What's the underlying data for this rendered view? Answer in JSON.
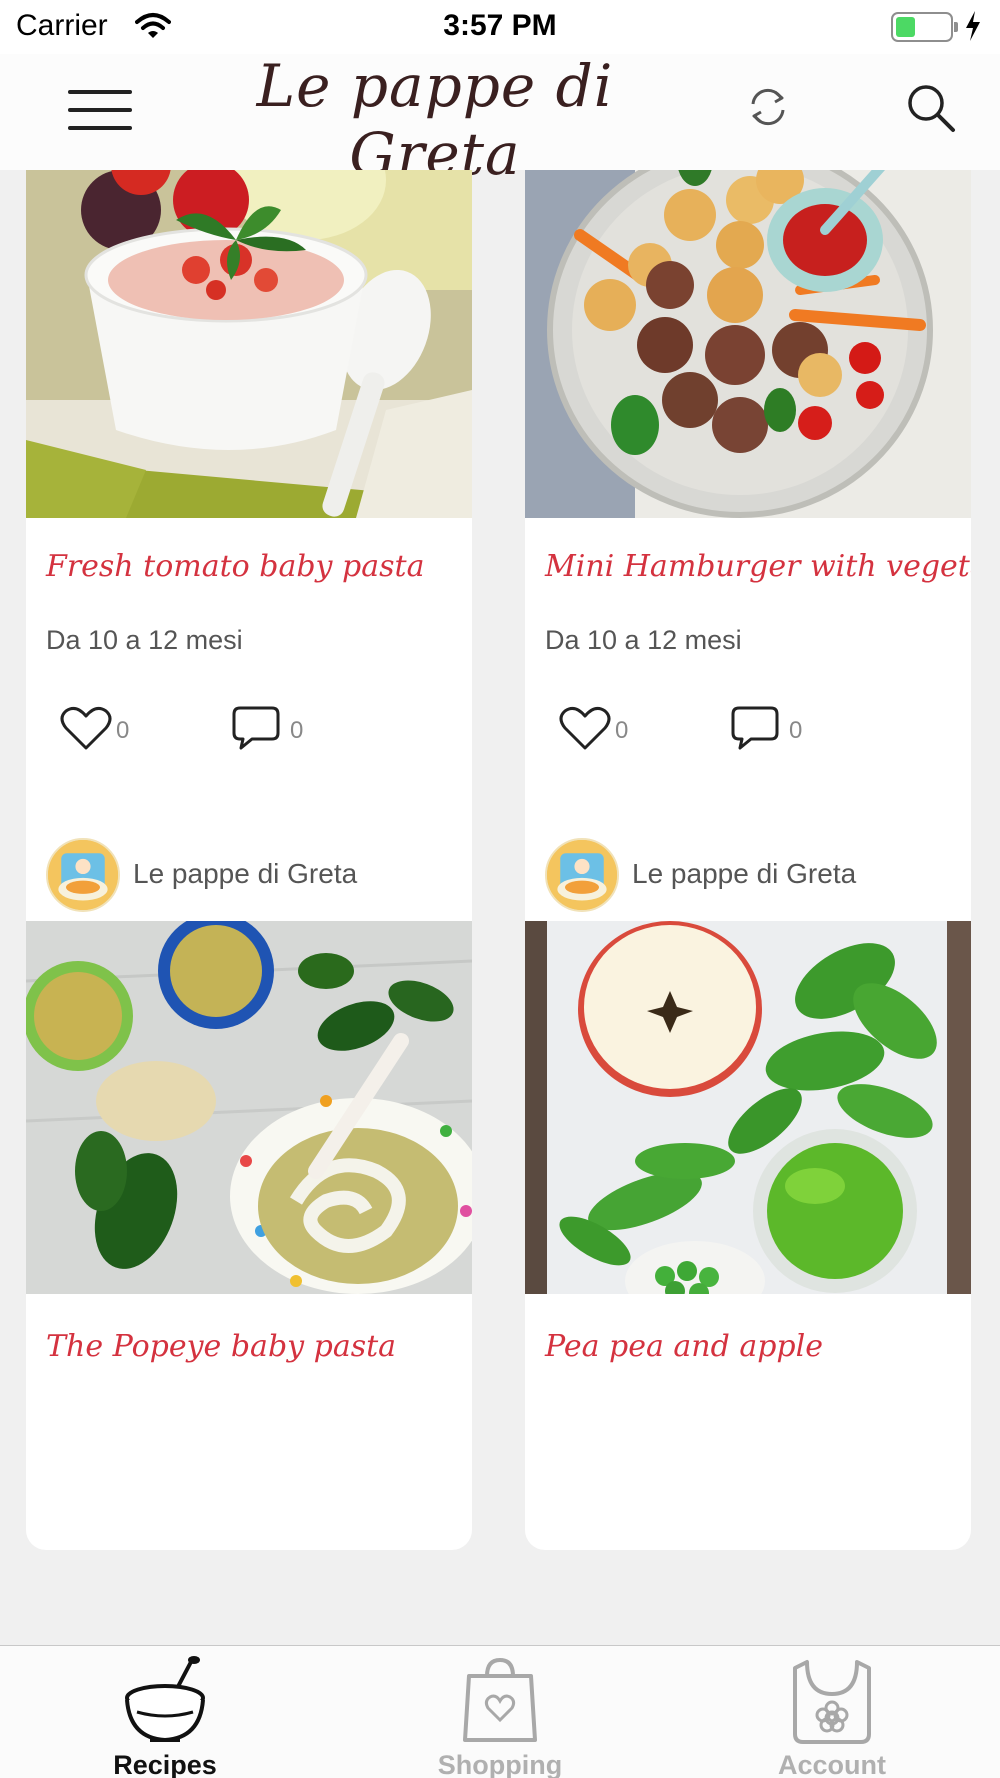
{
  "status_bar": {
    "carrier": "Carrier",
    "time": "3:57 PM",
    "battery_level": 0.35,
    "battery_color": "#4cd964"
  },
  "header": {
    "title": "Le pappe di Greta",
    "left_icon": "menu-icon",
    "right_icons": [
      "refresh-icon",
      "search-icon"
    ]
  },
  "recipes": [
    {
      "title": "Fresh tomato baby pasta",
      "age": "Da 10 a 12 mesi",
      "likes": "0",
      "comments": "0"
    },
    {
      "title": "Mini Hamburger with vegetables",
      "age": "Da 10 a 12 mesi",
      "likes": "0",
      "comments": "0"
    },
    {
      "author": "Le pappe di Greta",
      "title": "The Popeye baby pasta"
    },
    {
      "author": "Le pappe di Greta",
      "title": "Pea pea and apple"
    }
  ],
  "tabs": [
    {
      "label": "Recipes",
      "icon": "bowl-icon",
      "active": true
    },
    {
      "label": "Shopping",
      "icon": "shopping-bag-icon",
      "active": false
    },
    {
      "label": "Account",
      "icon": "bib-icon",
      "active": false
    }
  ],
  "colors": {
    "recipe_title": "#d4323f",
    "app_title": "#3a2020",
    "background": "#f0f0f0"
  }
}
